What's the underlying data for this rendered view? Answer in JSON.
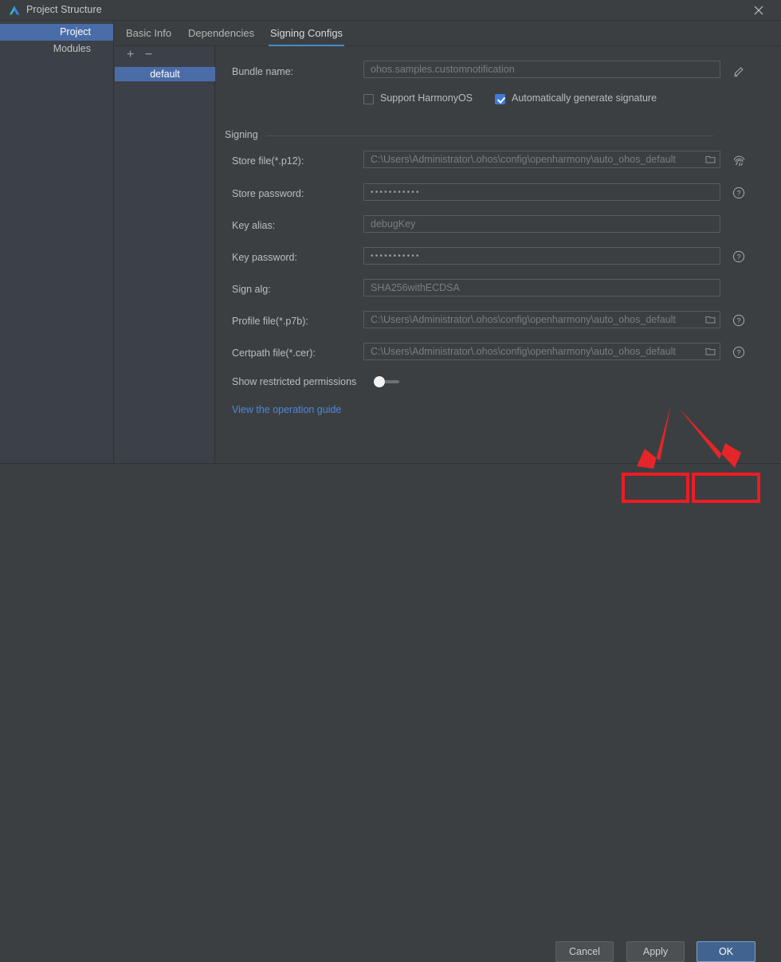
{
  "window": {
    "title": "Project Structure",
    "logo_icon": "deveco-triangle-logo",
    "close_icon": "close-icon"
  },
  "sidebar": {
    "items": [
      {
        "label": "Project",
        "selected": true
      },
      {
        "label": "Modules",
        "selected": false
      }
    ]
  },
  "config_list": {
    "add_icon": "plus-icon",
    "remove_icon": "minus-icon",
    "add_label": "+",
    "remove_label": "−",
    "items": [
      {
        "label": "default",
        "selected": true
      }
    ]
  },
  "tabs": [
    {
      "label": "Basic Info",
      "selected": false
    },
    {
      "label": "Dependencies",
      "selected": false
    },
    {
      "label": "Signing Configs",
      "selected": true
    }
  ],
  "main": {
    "bundle_name": {
      "label": "Bundle name:",
      "placeholder": "ohos.samples.customnotification",
      "value": "",
      "edit_icon": "pencil-edit-icon"
    },
    "checkboxes": [
      {
        "label": "Support HarmonyOS",
        "checked": false
      },
      {
        "label": "Automatically generate signature",
        "checked": true
      }
    ],
    "signing_group_title": "Signing",
    "fields": [
      {
        "label": "Store file(*.p12):",
        "placeholder": "C:\\Users\\Administrator\\.ohos\\config\\openharmony\\auto_ohos_default",
        "type": "file",
        "folder_icon": "folder-icon",
        "side_icon": "fingerprint-icon"
      },
      {
        "label": "Store password:",
        "placeholder": "•••••••••••",
        "type": "password",
        "side_icon": "help-icon"
      },
      {
        "label": "Key alias:",
        "placeholder": "debugKey",
        "type": "text",
        "side_icon": ""
      },
      {
        "label": "Key password:",
        "placeholder": "•••••••••••",
        "type": "password",
        "side_icon": "help-icon"
      },
      {
        "label": "Sign alg:",
        "placeholder": "SHA256withECDSA",
        "type": "text",
        "side_icon": ""
      },
      {
        "label": "Profile file(*.p7b):",
        "placeholder": "C:\\Users\\Administrator\\.ohos\\config\\openharmony\\auto_ohos_default",
        "type": "file",
        "folder_icon": "folder-icon",
        "side_icon": "help-icon"
      },
      {
        "label": "Certpath file(*.cer):",
        "placeholder": "C:\\Users\\Administrator\\.ohos\\config\\openharmony\\auto_ohos_default",
        "type": "file",
        "folder_icon": "folder-icon",
        "side_icon": "help-icon"
      }
    ],
    "restricted_permissions": {
      "label": "Show restricted permissions",
      "enabled": false
    },
    "guide_link": "View the operation guide"
  },
  "footer": {
    "cancel_label": "Cancel",
    "apply_label": "Apply",
    "ok_label": "OK"
  },
  "annotations": {
    "highlight_color": "#ec1c24",
    "arrow_count": 2,
    "targets": [
      "Apply",
      "OK"
    ]
  },
  "colors": {
    "accent_blue": "#4a6da7",
    "tab_underline": "#4a88c7",
    "link": "#4a88e0",
    "panel_bg": "#3c3f41",
    "sidebar_bg": "#3c4149",
    "primary_button": "#41638f",
    "annotation_red": "#ec1c24"
  }
}
